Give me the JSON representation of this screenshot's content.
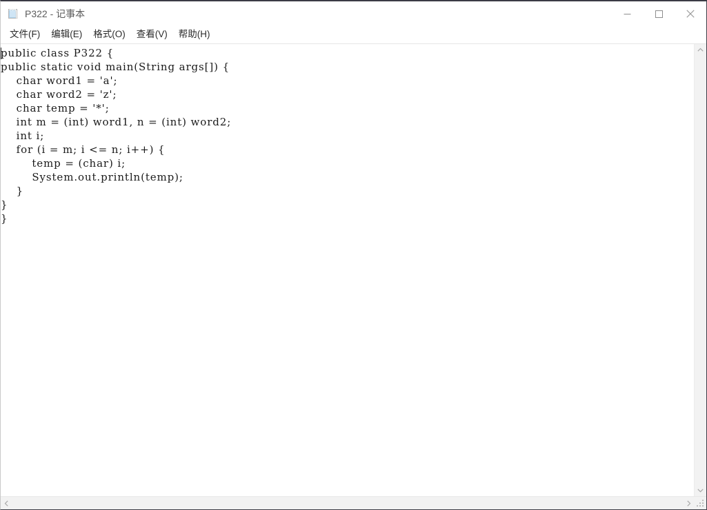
{
  "window": {
    "title": "P322 - 记事本",
    "app_icon": "notepad-icon"
  },
  "titlebar": {
    "minimize_label": "最小化",
    "maximize_label": "最大化",
    "close_label": "关闭",
    "minimize_icon": "minimize-icon",
    "maximize_icon": "maximize-icon",
    "close_icon": "close-icon"
  },
  "menubar": {
    "items": [
      {
        "label": "文件(F)"
      },
      {
        "label": "编辑(E)"
      },
      {
        "label": "格式(O)"
      },
      {
        "label": "查看(V)"
      },
      {
        "label": "帮助(H)"
      }
    ]
  },
  "editor": {
    "content": "public class P322 {\npublic static void main(String args[]) {\n    char word1 = 'a';\n    char word2 = 'z';\n    char temp = '*';\n    int m = (int) word1, n = (int) word2;\n    int i;\n    for (i = m; i <= n; i++) {\n        temp = (char) i;\n        System.out.println(temp);\n    }\n}\n}",
    "lines": [
      "public class P322 {",
      "public static void main(String args[]) {",
      "    char word1 = 'a';",
      "    char word2 = 'z';",
      "    char temp = '*';",
      "    int m = (int) word1, n = (int) word2;",
      "    int i;",
      "    for (i = m; i <= n; i++) {",
      "        temp = (char) i;",
      "        System.out.println(temp);",
      "    }",
      "}",
      "}"
    ]
  },
  "scrollbars": {
    "vertical": {
      "up_icon": "chevron-up-icon",
      "down_icon": "chevron-down-icon"
    },
    "horizontal": {
      "left_icon": "chevron-left-icon",
      "right_icon": "chevron-right-icon"
    },
    "resize_grip_icon": "resize-grip-icon"
  },
  "colors": {
    "window_bg": "#ffffff",
    "title_text": "#5c5c5c",
    "menu_text": "#2b2b2b",
    "code_text": "#1a1a1a",
    "scrollbar_track": "#f2f2f2",
    "scrollbar_arrow": "#9a9a9a",
    "border": "#3b3b45"
  }
}
